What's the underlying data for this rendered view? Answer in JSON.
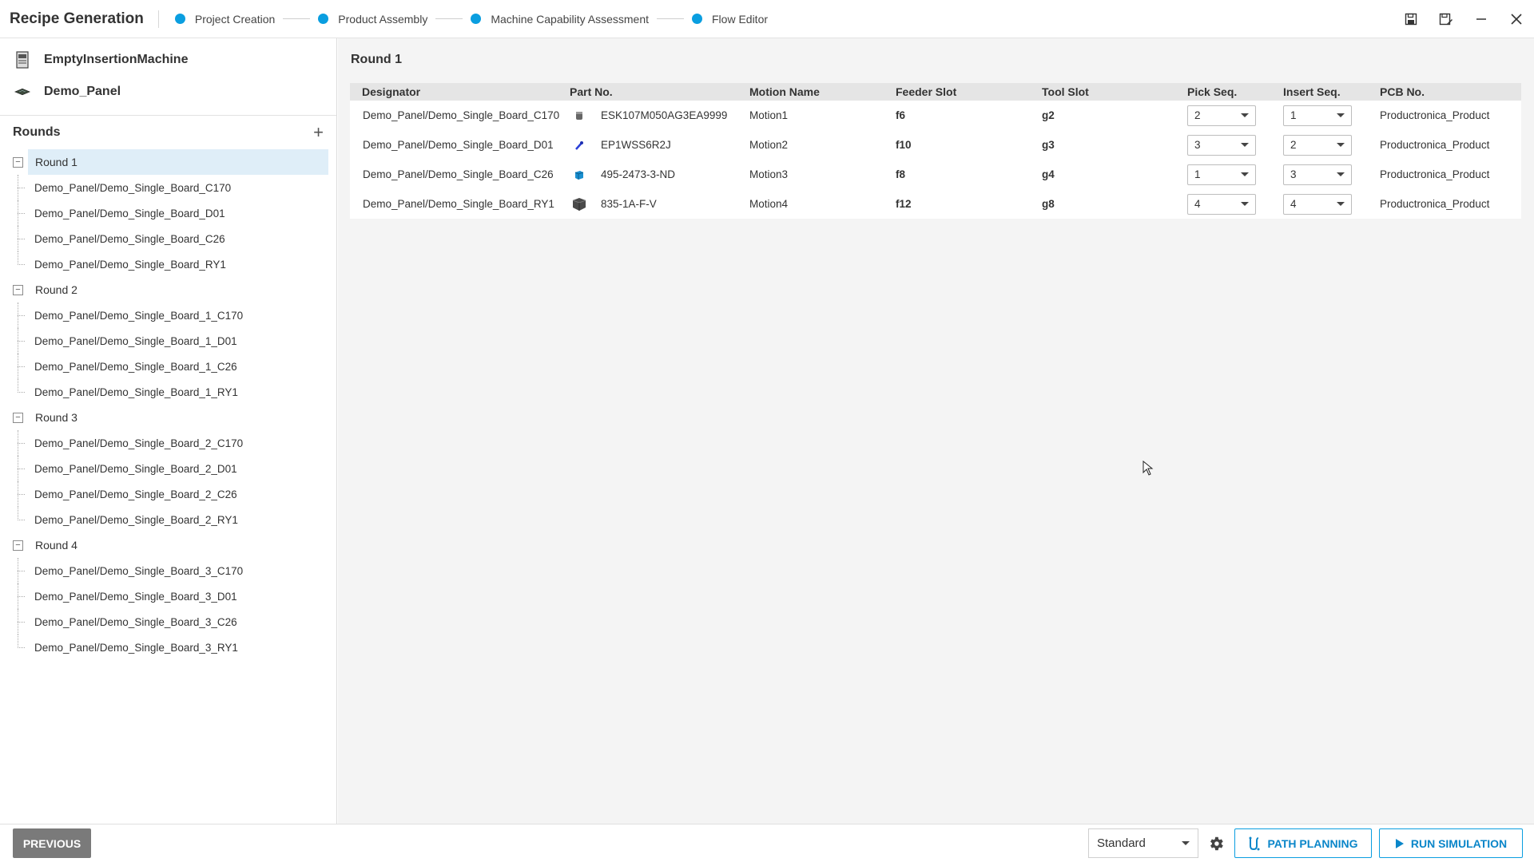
{
  "app": {
    "title": "Recipe Generation"
  },
  "steps": [
    {
      "label": "Project Creation"
    },
    {
      "label": "Product Assembly"
    },
    {
      "label": "Machine Capability Assessment"
    },
    {
      "label": "Flow Editor"
    }
  ],
  "sidebar": {
    "machine": "EmptyInsertionMachine",
    "panel": "Demo_Panel",
    "rounds_title": "Rounds",
    "rounds": [
      {
        "label": "Round 1",
        "items": [
          "Demo_Panel/Demo_Single_Board_C170",
          "Demo_Panel/Demo_Single_Board_D01",
          "Demo_Panel/Demo_Single_Board_C26",
          "Demo_Panel/Demo_Single_Board_RY1"
        ]
      },
      {
        "label": "Round 2",
        "items": [
          "Demo_Panel/Demo_Single_Board_1_C170",
          "Demo_Panel/Demo_Single_Board_1_D01",
          "Demo_Panel/Demo_Single_Board_1_C26",
          "Demo_Panel/Demo_Single_Board_1_RY1"
        ]
      },
      {
        "label": "Round 3",
        "items": [
          "Demo_Panel/Demo_Single_Board_2_C170",
          "Demo_Panel/Demo_Single_Board_2_D01",
          "Demo_Panel/Demo_Single_Board_2_C26",
          "Demo_Panel/Demo_Single_Board_2_RY1"
        ]
      },
      {
        "label": "Round 4",
        "items": [
          "Demo_Panel/Demo_Single_Board_3_C170",
          "Demo_Panel/Demo_Single_Board_3_D01",
          "Demo_Panel/Demo_Single_Board_3_C26",
          "Demo_Panel/Demo_Single_Board_3_RY1"
        ]
      }
    ]
  },
  "main": {
    "title": "Round 1",
    "columns": [
      "Designator",
      "Part No.",
      "Motion Name",
      "Feeder Slot",
      "Tool Slot",
      "Pick Seq.",
      "Insert Seq.",
      "PCB No."
    ],
    "rows": [
      {
        "designator": "Demo_Panel/Demo_Single_Board_C170",
        "part_no": "ESK107M050AG3EA9999",
        "part_icon": "capacitor-icon",
        "motion": "Motion1",
        "feeder": "f6",
        "tool": "g2",
        "pick": "2",
        "insert": "1",
        "pcb": "Productronica_Product"
      },
      {
        "designator": "Demo_Panel/Demo_Single_Board_D01",
        "part_no": "EP1WSS6R2J",
        "part_icon": "diode-icon",
        "motion": "Motion2",
        "feeder": "f10",
        "tool": "g3",
        "pick": "3",
        "insert": "2",
        "pcb": "Productronica_Product"
      },
      {
        "designator": "Demo_Panel/Demo_Single_Board_C26",
        "part_no": "495-2473-3-ND",
        "part_icon": "box-capacitor-icon",
        "motion": "Motion3",
        "feeder": "f8",
        "tool": "g4",
        "pick": "1",
        "insert": "3",
        "pcb": "Productronica_Product"
      },
      {
        "designator": "Demo_Panel/Demo_Single_Board_RY1",
        "part_no": "835-1A-F-V",
        "part_icon": "relay-icon",
        "motion": "Motion4",
        "feeder": "f12",
        "tool": "g8",
        "pick": "4",
        "insert": "4",
        "pcb": "Productronica_Product"
      }
    ]
  },
  "footer": {
    "previous": "PREVIOUS",
    "mode": "Standard",
    "path_planning": "PATH PLANNING",
    "run_simulation": "RUN SIMULATION"
  },
  "colors": {
    "accent": "#0a9ee0",
    "selected": "#dfeef8"
  }
}
